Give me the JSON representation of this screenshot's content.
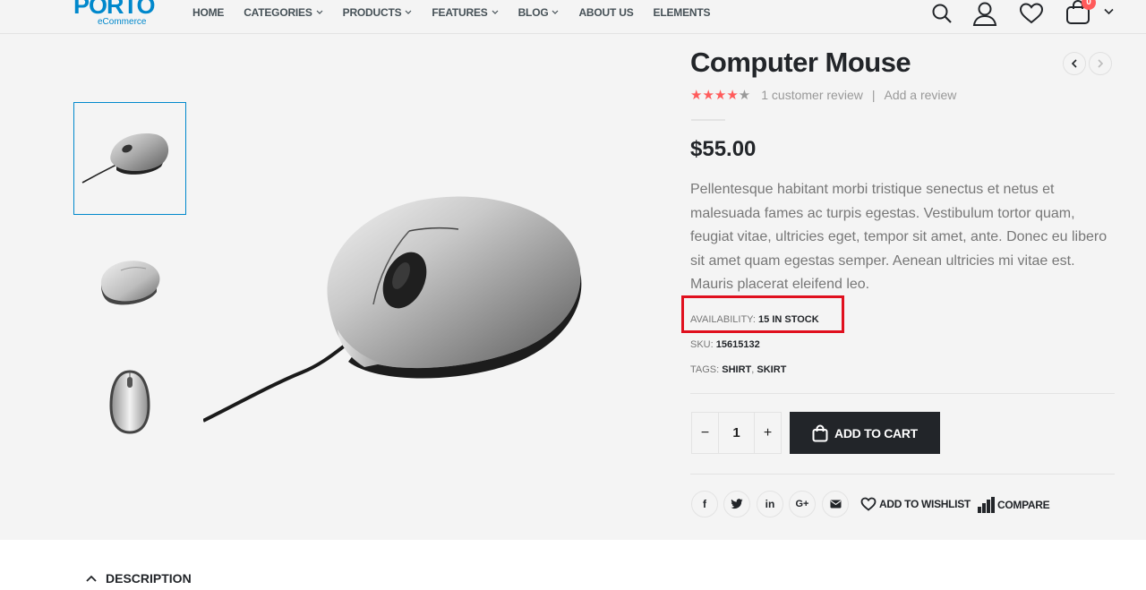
{
  "logo": {
    "brand": "PORTO",
    "tagline": "eCommerce"
  },
  "nav": [
    {
      "label": "HOME",
      "dropdown": false
    },
    {
      "label": "CATEGORIES",
      "dropdown": true
    },
    {
      "label": "PRODUCTS",
      "dropdown": true
    },
    {
      "label": "FEATURES",
      "dropdown": true
    },
    {
      "label": "BLOG",
      "dropdown": true
    },
    {
      "label": "ABOUT US",
      "dropdown": false
    },
    {
      "label": "ELEMENTS",
      "dropdown": false
    }
  ],
  "header_icons": [
    "search-icon",
    "user-icon",
    "heart-icon",
    "cart-icon"
  ],
  "cart": {
    "count": "0"
  },
  "product": {
    "title": "Computer Mouse",
    "rating": 4,
    "review_text": "1 customer review",
    "add_review": "Add a review",
    "price": "$55.00",
    "description": "Pellentesque habitant morbi tristique senectus et netus et malesuada fames ac turpis egestas. Vestibulum tortor quam, feugiat vitae, ultricies eget, tempor sit amet, ante. Donec eu libero sit amet quam egestas semper. Aenean ultricies mi vitae est. Mauris placerat eleifend leo.",
    "availability_label": "AVAILABILITY:",
    "availability_value": "15 IN STOCK",
    "sku_label": "SKU:",
    "sku_value": "15615132",
    "tags_label": "TAGS:",
    "tags": [
      "SHIRT",
      "SKIRT"
    ],
    "quantity": "1"
  },
  "buttons": {
    "minus": "−",
    "plus": "+",
    "add_to_cart": "ADD TO CART",
    "add_to_wishlist": "ADD TO WISHLIST",
    "compare": "COMPARE"
  },
  "share": [
    {
      "name": "facebook",
      "glyph": "f"
    },
    {
      "name": "twitter",
      "glyph": "t"
    },
    {
      "name": "linkedin",
      "glyph": "in"
    },
    {
      "name": "google-plus",
      "glyph": "G+"
    },
    {
      "name": "email",
      "glyph": "✉"
    }
  ],
  "tabs": {
    "description": "DESCRIPTION"
  },
  "colors": {
    "accent": "#0088cc",
    "dark": "#222529",
    "star": "#ff5b5b",
    "highlight": "#e0101e"
  }
}
